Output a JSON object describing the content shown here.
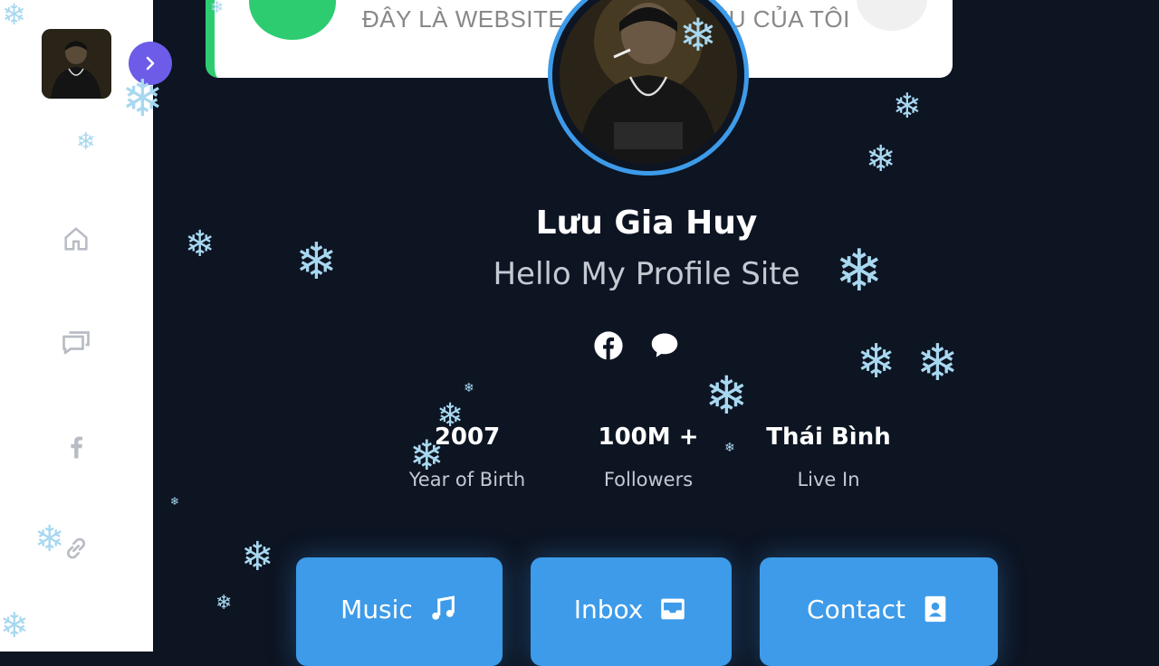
{
  "sidebar": {
    "avatar_alt": "avatar",
    "toggle_icon": "chevron-right-icon",
    "items": [
      {
        "icon": "home-icon"
      },
      {
        "icon": "chat-icon"
      },
      {
        "icon": "facebook-icon"
      },
      {
        "icon": "link-icon"
      }
    ]
  },
  "top_card": {
    "marquee": "ĐÂY LÀ WEBSITE TỰ GIỚI THIỆU CỦA TÔI"
  },
  "profile": {
    "name": "Lưu Gia Huy",
    "subtitle": "Hello My Profile Site",
    "socials": [
      {
        "icon": "facebook-icon"
      },
      {
        "icon": "chat-bubble-icon"
      }
    ]
  },
  "stats": [
    {
      "value": "2007",
      "label": "Year of Birth"
    },
    {
      "value": "100M +",
      "label": "Followers"
    },
    {
      "value": "Thái Bình",
      "label": "Live In"
    }
  ],
  "buttons": [
    {
      "label": "Music",
      "icon": "music-note-icon"
    },
    {
      "label": "Inbox",
      "icon": "inbox-icon"
    },
    {
      "label": "Contact",
      "icon": "contact-card-icon"
    }
  ],
  "colors": {
    "background": "#0d1422",
    "accent": "#3d9be9",
    "green": "#2ecc71",
    "purple": "#6c5ce7"
  }
}
